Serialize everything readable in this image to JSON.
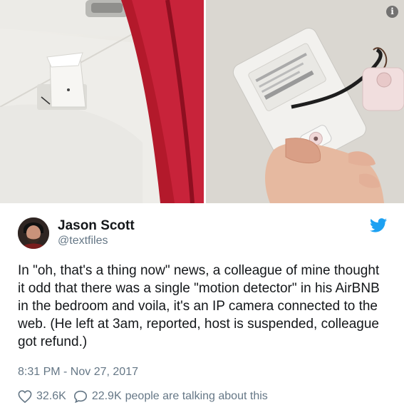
{
  "tweet": {
    "author_name": "Jason Scott",
    "author_handle": "@textfiles",
    "text": "In \"oh, that's a thing now\" news, a colleague of mine thought it odd that there was a single \"motion detector\" in his AirBNB in the bedroom and voila, it's an IP camera connected to the web. (He left at 3am, reported, host is suspended, colleague got refund.)",
    "timestamp": "8:31 PM - Nov 27, 2017",
    "likes": "32.6K",
    "replies": "22.9K",
    "replies_suffix": "people are talking about this"
  },
  "icons": {
    "info": "info-icon",
    "bird": "twitter-bird-icon",
    "heart": "heart-icon",
    "reply": "reply-bubble-icon"
  },
  "colors": {
    "twitter_blue": "#1da1f2",
    "secondary_text": "#657786",
    "primary_text": "#14171a"
  }
}
